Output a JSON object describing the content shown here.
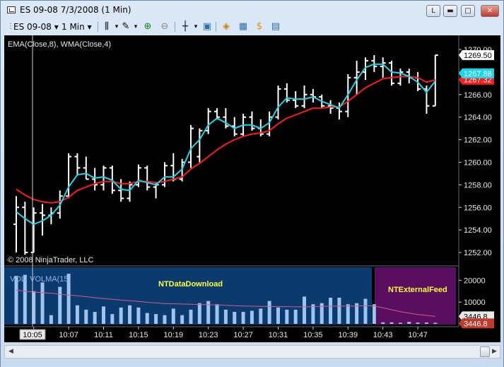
{
  "window": {
    "title": "ES 09-08  7/3/2008 (1 Min)"
  },
  "toolbar": {
    "instrument": "ES 09-08",
    "interval": "1 Min",
    "dropdown_glyph": "▾",
    "icons": [
      "bar-type-icon",
      "drawing-pencil-icon",
      "zoom-in-icon",
      "zoom-out-icon",
      "crosshair-icon",
      "snapshot-icon",
      "strategies-icon",
      "indicators-icon",
      "dollar-icon",
      "data-box-icon"
    ]
  },
  "chart": {
    "indicator_label": "EMA(Close,8), WMA(Close,4)",
    "copyright": "© 2008 NinjaTrader, LLC",
    "price_labels": [
      "1252.00",
      "1254.00",
      "1256.00",
      "1258.00",
      "1260.00",
      "1262.00",
      "1264.00",
      "1266.00",
      "1268.00",
      "1270.00"
    ],
    "last_price": "1269.50",
    "wma_value": "1267.88",
    "ema_value": "1267.32",
    "volume_label": "VOL, VOLMA(15)",
    "volume_axis": [
      "10000",
      "20000"
    ],
    "volume_last": "3446.8",
    "volume_ma_last": "3446.8",
    "region_download": "NTDataDownload",
    "region_external": "NTExternalFeed",
    "time_labels": [
      "10:03",
      "10:07",
      "10:11",
      "10:15",
      "10:19",
      "10:23",
      "10:27",
      "10:31",
      "10:35",
      "10:39",
      "10:43",
      "10:47"
    ],
    "crosshair_time": "10:05",
    "colors": {
      "ema": "#ff1a1a",
      "wma": "#19d7e8",
      "download_bg": "#0b3a6e",
      "external_bg": "#5a0e60",
      "price_tag": "#1b66b7"
    }
  },
  "chart_data": {
    "type": "bar",
    "title": "",
    "ylim": [
      1251,
      1271
    ],
    "x": [
      "10:01",
      "10:02",
      "10:03",
      "10:04",
      "10:05",
      "10:06",
      "10:07",
      "10:08",
      "10:09",
      "10:10",
      "10:11",
      "10:12",
      "10:13",
      "10:14",
      "10:15",
      "10:16",
      "10:17",
      "10:18",
      "10:19",
      "10:20",
      "10:21",
      "10:22",
      "10:23",
      "10:24",
      "10:25",
      "10:26",
      "10:27",
      "10:28",
      "10:29",
      "10:30",
      "10:31",
      "10:32",
      "10:33",
      "10:34",
      "10:35",
      "10:36",
      "10:37",
      "10:38",
      "10:39",
      "10:40",
      "10:41",
      "10:42",
      "10:43",
      "10:44",
      "10:45",
      "10:46",
      "10:47",
      "10:48",
      "10:49"
    ],
    "ohlc": [
      [
        1254.5,
        1257.0,
        1252.0,
        1256.0
      ],
      [
        1256.0,
        1256.5,
        1251.8,
        1252.0
      ],
      [
        1252.0,
        1256.0,
        1252.0,
        1255.5
      ],
      [
        1255.5,
        1256.3,
        1253.5,
        1255.3
      ],
      [
        1255.3,
        1256.0,
        1254.5,
        1255.5
      ],
      [
        1255.5,
        1257.5,
        1255.0,
        1257.0
      ],
      [
        1257.0,
        1260.8,
        1256.8,
        1260.5
      ],
      [
        1260.5,
        1260.8,
        1258.8,
        1259.5
      ],
      [
        1259.5,
        1260.5,
        1258.5,
        1258.5
      ],
      [
        1258.5,
        1259.5,
        1257.5,
        1258.0
      ],
      [
        1258.0,
        1259.7,
        1257.5,
        1259.5
      ],
      [
        1259.5,
        1259.7,
        1257.2,
        1257.5
      ],
      [
        1257.5,
        1258.5,
        1256.5,
        1256.8
      ],
      [
        1256.8,
        1258.3,
        1256.5,
        1258.0
      ],
      [
        1258.0,
        1259.8,
        1257.8,
        1259.5
      ],
      [
        1259.5,
        1259.7,
        1257.5,
        1257.8
      ],
      [
        1257.8,
        1258.2,
        1256.8,
        1258.0
      ],
      [
        1258.0,
        1260.0,
        1257.8,
        1259.7
      ],
      [
        1259.7,
        1260.8,
        1258.3,
        1258.5
      ],
      [
        1258.5,
        1260.3,
        1258.3,
        1260.0
      ],
      [
        1260.0,
        1263.3,
        1259.5,
        1263.0
      ],
      [
        1260.5,
        1263.0,
        1260.0,
        1262.8
      ],
      [
        1262.8,
        1264.8,
        1262.5,
        1264.5
      ],
      [
        1264.5,
        1264.8,
        1263.8,
        1264.0
      ],
      [
        1264.0,
        1264.8,
        1263.0,
        1263.2
      ],
      [
        1263.2,
        1264.0,
        1262.3,
        1262.5
      ],
      [
        1262.5,
        1264.3,
        1262.3,
        1264.0
      ],
      [
        1264.0,
        1264.5,
        1262.8,
        1263.0
      ],
      [
        1263.0,
        1263.8,
        1262.3,
        1262.5
      ],
      [
        1262.5,
        1264.5,
        1262.3,
        1264.0
      ],
      [
        1264.0,
        1266.8,
        1263.8,
        1266.5
      ],
      [
        1266.5,
        1267.0,
        1265.3,
        1265.5
      ],
      [
        1265.5,
        1266.3,
        1264.8,
        1265.0
      ],
      [
        1265.0,
        1266.8,
        1264.8,
        1266.0
      ],
      [
        1266.0,
        1266.5,
        1265.3,
        1265.8
      ],
      [
        1265.8,
        1266.0,
        1264.8,
        1265.0
      ],
      [
        1265.0,
        1265.5,
        1264.3,
        1264.8
      ],
      [
        1264.8,
        1265.3,
        1263.8,
        1264.5
      ],
      [
        1264.5,
        1267.8,
        1264.0,
        1267.5
      ],
      [
        1267.5,
        1269.0,
        1266.0,
        1268.0
      ],
      [
        1268.0,
        1269.3,
        1267.3,
        1269.0
      ],
      [
        1269.0,
        1269.5,
        1268.0,
        1268.5
      ],
      [
        1268.5,
        1269.3,
        1267.5,
        1268.8
      ],
      [
        1268.8,
        1269.0,
        1266.8,
        1267.0
      ],
      [
        1267.0,
        1268.3,
        1266.8,
        1268.0
      ],
      [
        1268.0,
        1268.3,
        1267.0,
        1267.5
      ],
      [
        1267.5,
        1268.0,
        1266.3,
        1266.5
      ],
      [
        1266.5,
        1266.8,
        1264.3,
        1265.0
      ],
      [
        1265.0,
        1269.5,
        1265.0,
        1269.5
      ]
    ],
    "wma": [
      1255.6,
      1255.0,
      1254.5,
      1254.8,
      1255.3,
      1256.2,
      1257.8,
      1258.9,
      1259.0,
      1258.6,
      1258.7,
      1258.4,
      1257.6,
      1257.5,
      1258.4,
      1258.2,
      1258.0,
      1258.7,
      1258.7,
      1259.4,
      1261.2,
      1262.0,
      1263.3,
      1263.9,
      1263.5,
      1263.0,
      1263.3,
      1263.3,
      1263.0,
      1263.5,
      1264.9,
      1265.7,
      1265.6,
      1265.6,
      1265.8,
      1265.4,
      1265.1,
      1264.8,
      1266.0,
      1267.3,
      1268.4,
      1268.7,
      1268.7,
      1268.0,
      1267.9,
      1267.6,
      1267.1,
      1266.2,
      1267.2
    ],
    "ema": [
      1257.6,
      1257.1,
      1256.7,
      1256.5,
      1256.4,
      1256.5,
      1256.9,
      1257.5,
      1257.8,
      1258.1,
      1258.3,
      1258.3,
      1258.1,
      1258.1,
      1258.3,
      1258.3,
      1258.2,
      1258.3,
      1258.5,
      1258.7,
      1259.4,
      1259.9,
      1260.5,
      1261.1,
      1261.6,
      1262.0,
      1262.3,
      1262.5,
      1262.6,
      1262.8,
      1263.4,
      1263.9,
      1264.2,
      1264.5,
      1264.8,
      1264.8,
      1264.9,
      1264.9,
      1265.4,
      1266.0,
      1266.6,
      1267.0,
      1267.4,
      1267.5,
      1267.6,
      1267.6,
      1267.5,
      1267.1,
      1267.3
    ],
    "volume": [
      22000,
      22500,
      15000,
      19000,
      4000,
      17000,
      23000,
      8500,
      6500,
      5500,
      8000,
      4500,
      7500,
      8500,
      7500,
      5000,
      4500,
      4000,
      7000,
      4000,
      6500,
      9500,
      10500,
      9000,
      6500,
      5500,
      5500,
      6000,
      7000,
      10500,
      7500,
      6500,
      6500,
      12500,
      9000,
      9500,
      12000,
      12000,
      9000,
      9500,
      11500,
      9000,
      700,
      700,
      500,
      900,
      600,
      600,
      500
    ],
    "volume_ma": [
      15500,
      15000,
      14600,
      14300,
      14000,
      13600,
      13200,
      12900,
      12500,
      12000,
      11600,
      11300,
      10900,
      10600,
      10300,
      9900,
      9600,
      9300,
      9200,
      9100,
      9000,
      8900,
      8800,
      8700,
      8500,
      8300,
      8200,
      8100,
      8000,
      8000,
      7900,
      7900,
      7800,
      7800,
      7900,
      8000,
      8100,
      8100,
      8200,
      8200,
      8300,
      8200,
      7400,
      6500,
      5600,
      4900,
      4300,
      3900,
      3447
    ]
  }
}
